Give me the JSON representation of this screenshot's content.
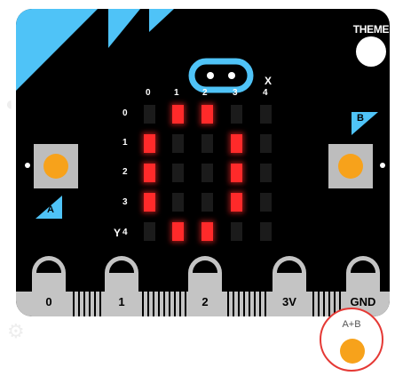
{
  "theme": {
    "label": "THEME"
  },
  "matrix": {
    "x_axis_name": "X",
    "y_axis_name": "Y",
    "x_labels": [
      "0",
      "1",
      "2",
      "3",
      "4"
    ],
    "y_labels": [
      "0",
      "1",
      "2",
      "3",
      "4"
    ],
    "rows": [
      [
        0,
        1,
        1,
        0,
        0
      ],
      [
        1,
        0,
        0,
        1,
        0
      ],
      [
        1,
        0,
        0,
        1,
        0
      ],
      [
        1,
        0,
        0,
        1,
        0
      ],
      [
        0,
        1,
        1,
        0,
        0
      ]
    ]
  },
  "buttons": {
    "a": {
      "label": "A"
    },
    "b": {
      "label": "B"
    },
    "ab": {
      "label": "A+B"
    }
  },
  "pins": [
    {
      "label": "0"
    },
    {
      "label": "1"
    },
    {
      "label": "2"
    },
    {
      "label": "3V"
    },
    {
      "label": "GND"
    }
  ],
  "colors": {
    "board": "#000000",
    "accent": "#4fc3f7",
    "led_on": "#ff2a2a",
    "led_off": "#1b1b1b",
    "button_knob": "#f7a21b",
    "button_base": "#bdbdbd",
    "edge_connector": "#c4c4c4",
    "highlight_ring": "#e53935"
  }
}
